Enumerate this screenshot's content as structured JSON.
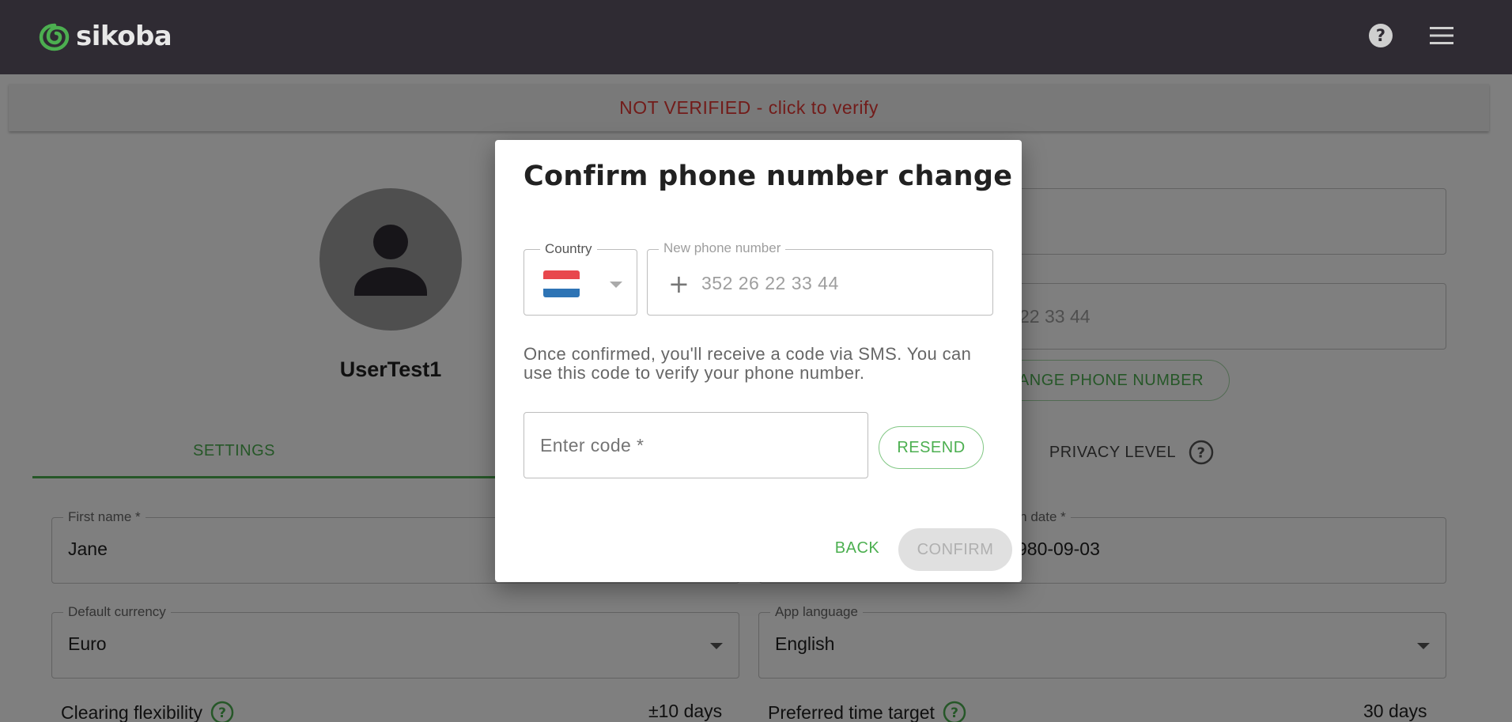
{
  "app": {
    "logo_text": "sikoba",
    "logo_icon": "spiral-logo-icon",
    "help_icon": "help-circle-icon",
    "menu_icon": "hamburger-menu-icon"
  },
  "banner": {
    "text": "NOT VERIFIED - click to verify",
    "color": "#e53935"
  },
  "profile": {
    "username": "UserTest1",
    "avatar_icon": "person-icon"
  },
  "right_fields": {
    "phone_partial": "22 33 44",
    "change_phone_label": "HANGE PHONE NUMBER"
  },
  "tabs": {
    "settings": "SETTINGS",
    "privacy": "PRIVACY LEVEL"
  },
  "form": {
    "first_name_label": "First name *",
    "first_name_value": "Jane",
    "birth_date_label": "irth date *",
    "birth_date_value": "980-09-03",
    "currency_label": "Default currency",
    "currency_value": "Euro",
    "language_label": "App language",
    "language_value": "English",
    "clearing_label": "Clearing flexibility",
    "clearing_value": "±10 days",
    "time_target_label": "Preferred time target",
    "time_target_value": "30 days"
  },
  "dialog": {
    "title": "Confirm phone number change",
    "country_label": "Country",
    "phone_label": "New phone number",
    "phone_prefix": "+",
    "phone_placeholder": "352 26 22 33 44",
    "info_text": "Once confirmed, you'll receive a code via SMS. You can use this code to verify your phone number.",
    "code_placeholder": "Enter code *",
    "resend_label": "RESEND",
    "back_label": "BACK",
    "confirm_label": "CONFIRM",
    "flag_colors": [
      "#e8474d",
      "#ffffff",
      "#2e74b5"
    ]
  },
  "colors": {
    "accent": "#4caf50",
    "topbar": "#2f2b33"
  }
}
